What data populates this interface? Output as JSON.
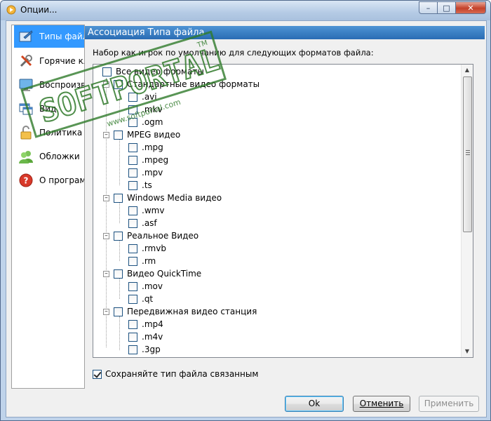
{
  "window": {
    "title": "Опции...",
    "caption_buttons": {
      "minimize": "–",
      "maximize": "□",
      "close": "✕"
    }
  },
  "sidebar": {
    "items": [
      {
        "label": "Типы файл",
        "icon": "video-file-icon",
        "selected": true
      },
      {
        "label": "Горячие кл",
        "icon": "tools-icon",
        "selected": false
      },
      {
        "label": "Воспроизве",
        "icon": "monitor-icon",
        "selected": false
      },
      {
        "label": "Вид",
        "icon": "window-icon",
        "selected": false
      },
      {
        "label": "Политика к",
        "icon": "lock-icon",
        "selected": false
      },
      {
        "label": "Обложки",
        "icon": "users-icon",
        "selected": false
      },
      {
        "label": "О программ",
        "icon": "help-icon",
        "selected": false
      }
    ]
  },
  "main": {
    "header": "Ассоциация Типа файла",
    "description": "Набор как игрок по умолчанию для следующих форматов файла:",
    "tree": {
      "root": "Все видео форматы",
      "groups": [
        {
          "label": "Стандартные видео форматы",
          "items": [
            ".avi",
            ".mkv",
            ".ogm"
          ]
        },
        {
          "label": "MPEG видео",
          "items": [
            ".mpg",
            ".mpeg",
            ".mpv",
            ".ts"
          ]
        },
        {
          "label": "Windows Media видео",
          "items": [
            ".wmv",
            ".asf"
          ]
        },
        {
          "label": "Реальное Видео",
          "items": [
            ".rmvb",
            ".rm"
          ]
        },
        {
          "label": "Видео QuickTime",
          "items": [
            ".mov",
            ".qt"
          ]
        },
        {
          "label": "Передвижная видео станция",
          "items": [
            ".mp4",
            ".m4v",
            ".3gp"
          ]
        }
      ],
      "expander_collapse": "–",
      "scroll_up": "▲",
      "scroll_down": "▼"
    },
    "keep_association": {
      "label": "Сохраняйте тип файла связанным",
      "checked": true
    }
  },
  "buttons": {
    "ok": "Ok",
    "cancel": "Отменить",
    "apply": "Применить"
  },
  "watermark": {
    "text": "SOFTPORTAL",
    "tm": "TM",
    "url": "www.softportal.com"
  },
  "colors": {
    "selection": "#3399ff",
    "header": "#2a6cb4",
    "watermark": "#2f7a2a"
  }
}
